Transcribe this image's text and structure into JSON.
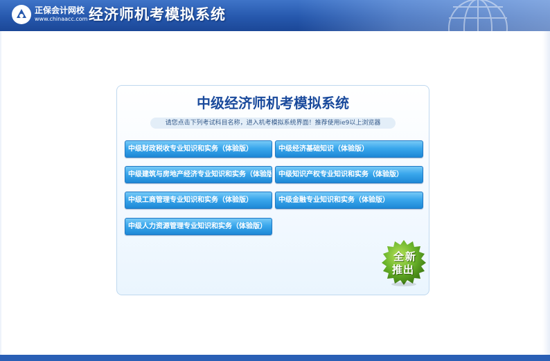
{
  "header": {
    "brand_name": "正保会计网校",
    "brand_url": "www.chinaacc.com",
    "system_title": "经济师机考模拟系统",
    "logo_icon": "chinaacc-logo-icon",
    "globe_icon": "globe-icon"
  },
  "panel": {
    "title": "中级经济师机考模拟系统",
    "notice": "请您点击下列考试科目名称，进入机考模拟系统界面！推荐使用ie9以上浏览器"
  },
  "courses": [
    "中级财政税收专业知识和实务（体验版）",
    "中级经济基础知识（体验版）",
    "中级建筑与房地产经济专业知识和实务（体验版）",
    "中级知识产权专业知识和实务（体验版）",
    "中级工商管理专业知识和实务（体验版）",
    "中级金融专业知识和实务（体验版）",
    "中级人力资源管理专业知识和实务（体验版）"
  ],
  "badge": {
    "line1": "全新",
    "line2": "推出",
    "color": "#6ab42a"
  },
  "colors": {
    "header_blue": "#2658ad",
    "button_blue": "#3aa7ec",
    "title_blue": "#1a4a9c"
  }
}
